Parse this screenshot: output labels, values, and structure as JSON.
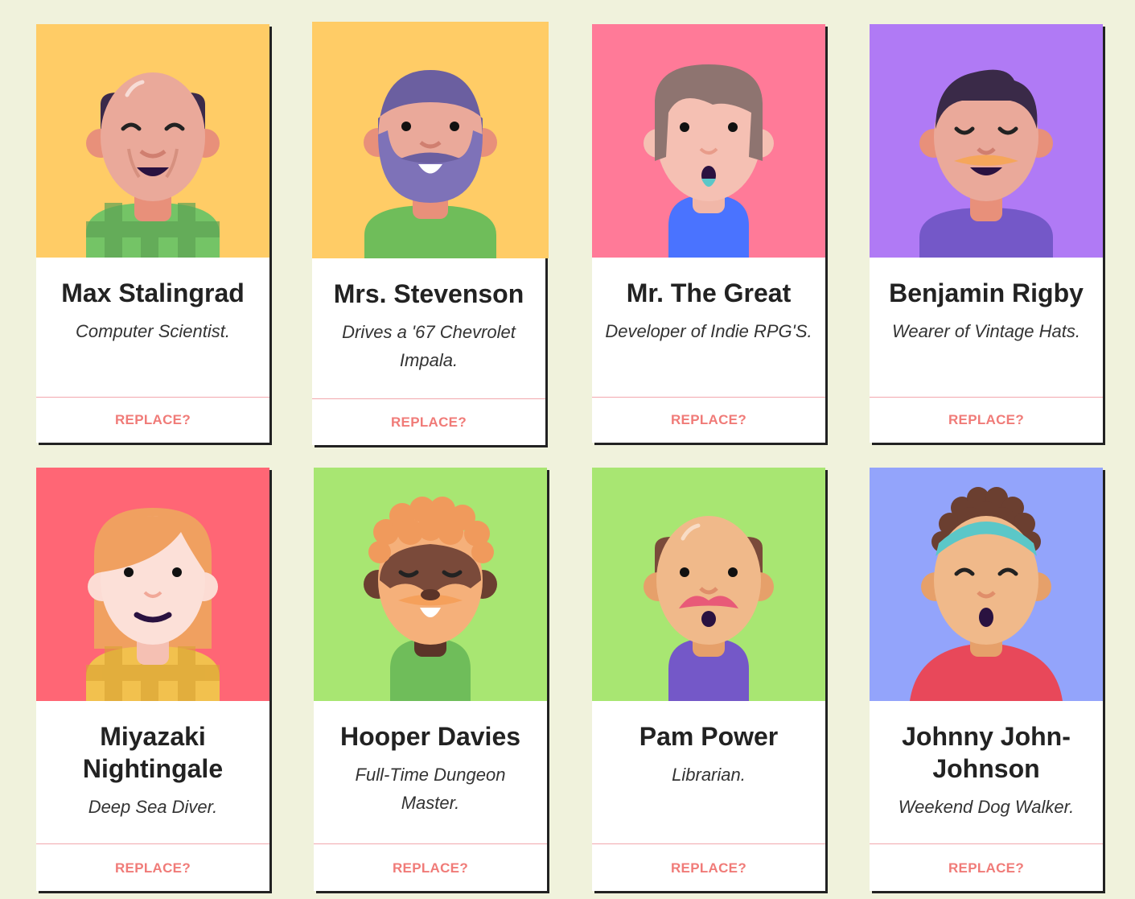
{
  "colors": {
    "page_background": "#f0f2dc",
    "replace_text": "#f07b78",
    "divider": "#f2a8ad"
  },
  "cards": [
    {
      "name": "Max Stalingrad",
      "description": "Computer Scientist.",
      "action_label": "REPLACE?",
      "avatar_bg": "#ffcc66",
      "avatar_icon": "bald-man-glasses-face-icon"
    },
    {
      "name": "Mrs. Stevenson",
      "description": "Drives a '67 Chevrolet Impala.",
      "action_label": "REPLACE?",
      "avatar_bg": "#ffcc66",
      "avatar_icon": "bearded-man-face-icon"
    },
    {
      "name": "Mr. The Great",
      "description": "Developer of Indie RPG'S.",
      "action_label": "REPLACE?",
      "avatar_bg": "#ff7a98",
      "avatar_icon": "surprised-man-face-icon"
    },
    {
      "name": "Benjamin Rigby",
      "description": "Wearer of Vintage Hats.",
      "action_label": "REPLACE?",
      "avatar_bg": "#b07af5",
      "avatar_icon": "mustached-man-face-icon"
    },
    {
      "name": "Miyazaki Nightingale",
      "description": "Deep Sea Diver.",
      "action_label": "REPLACE?",
      "avatar_bg": "#ff6675",
      "avatar_icon": "woman-face-icon"
    },
    {
      "name": "Hooper Davies",
      "description": "Full-Time Dungeon Master.",
      "action_label": "REPLACE?",
      "avatar_bg": "#a8e672",
      "avatar_icon": "curly-hair-man-face-icon"
    },
    {
      "name": "Pam Power",
      "description": "Librarian.",
      "action_label": "REPLACE?",
      "avatar_bg": "#a8e672",
      "avatar_icon": "bald-mustache-face-icon"
    },
    {
      "name": "Johnny John-Johnson",
      "description": "Weekend Dog Walker.",
      "action_label": "REPLACE?",
      "avatar_bg": "#93a4fb",
      "avatar_icon": "headband-face-icon"
    }
  ]
}
